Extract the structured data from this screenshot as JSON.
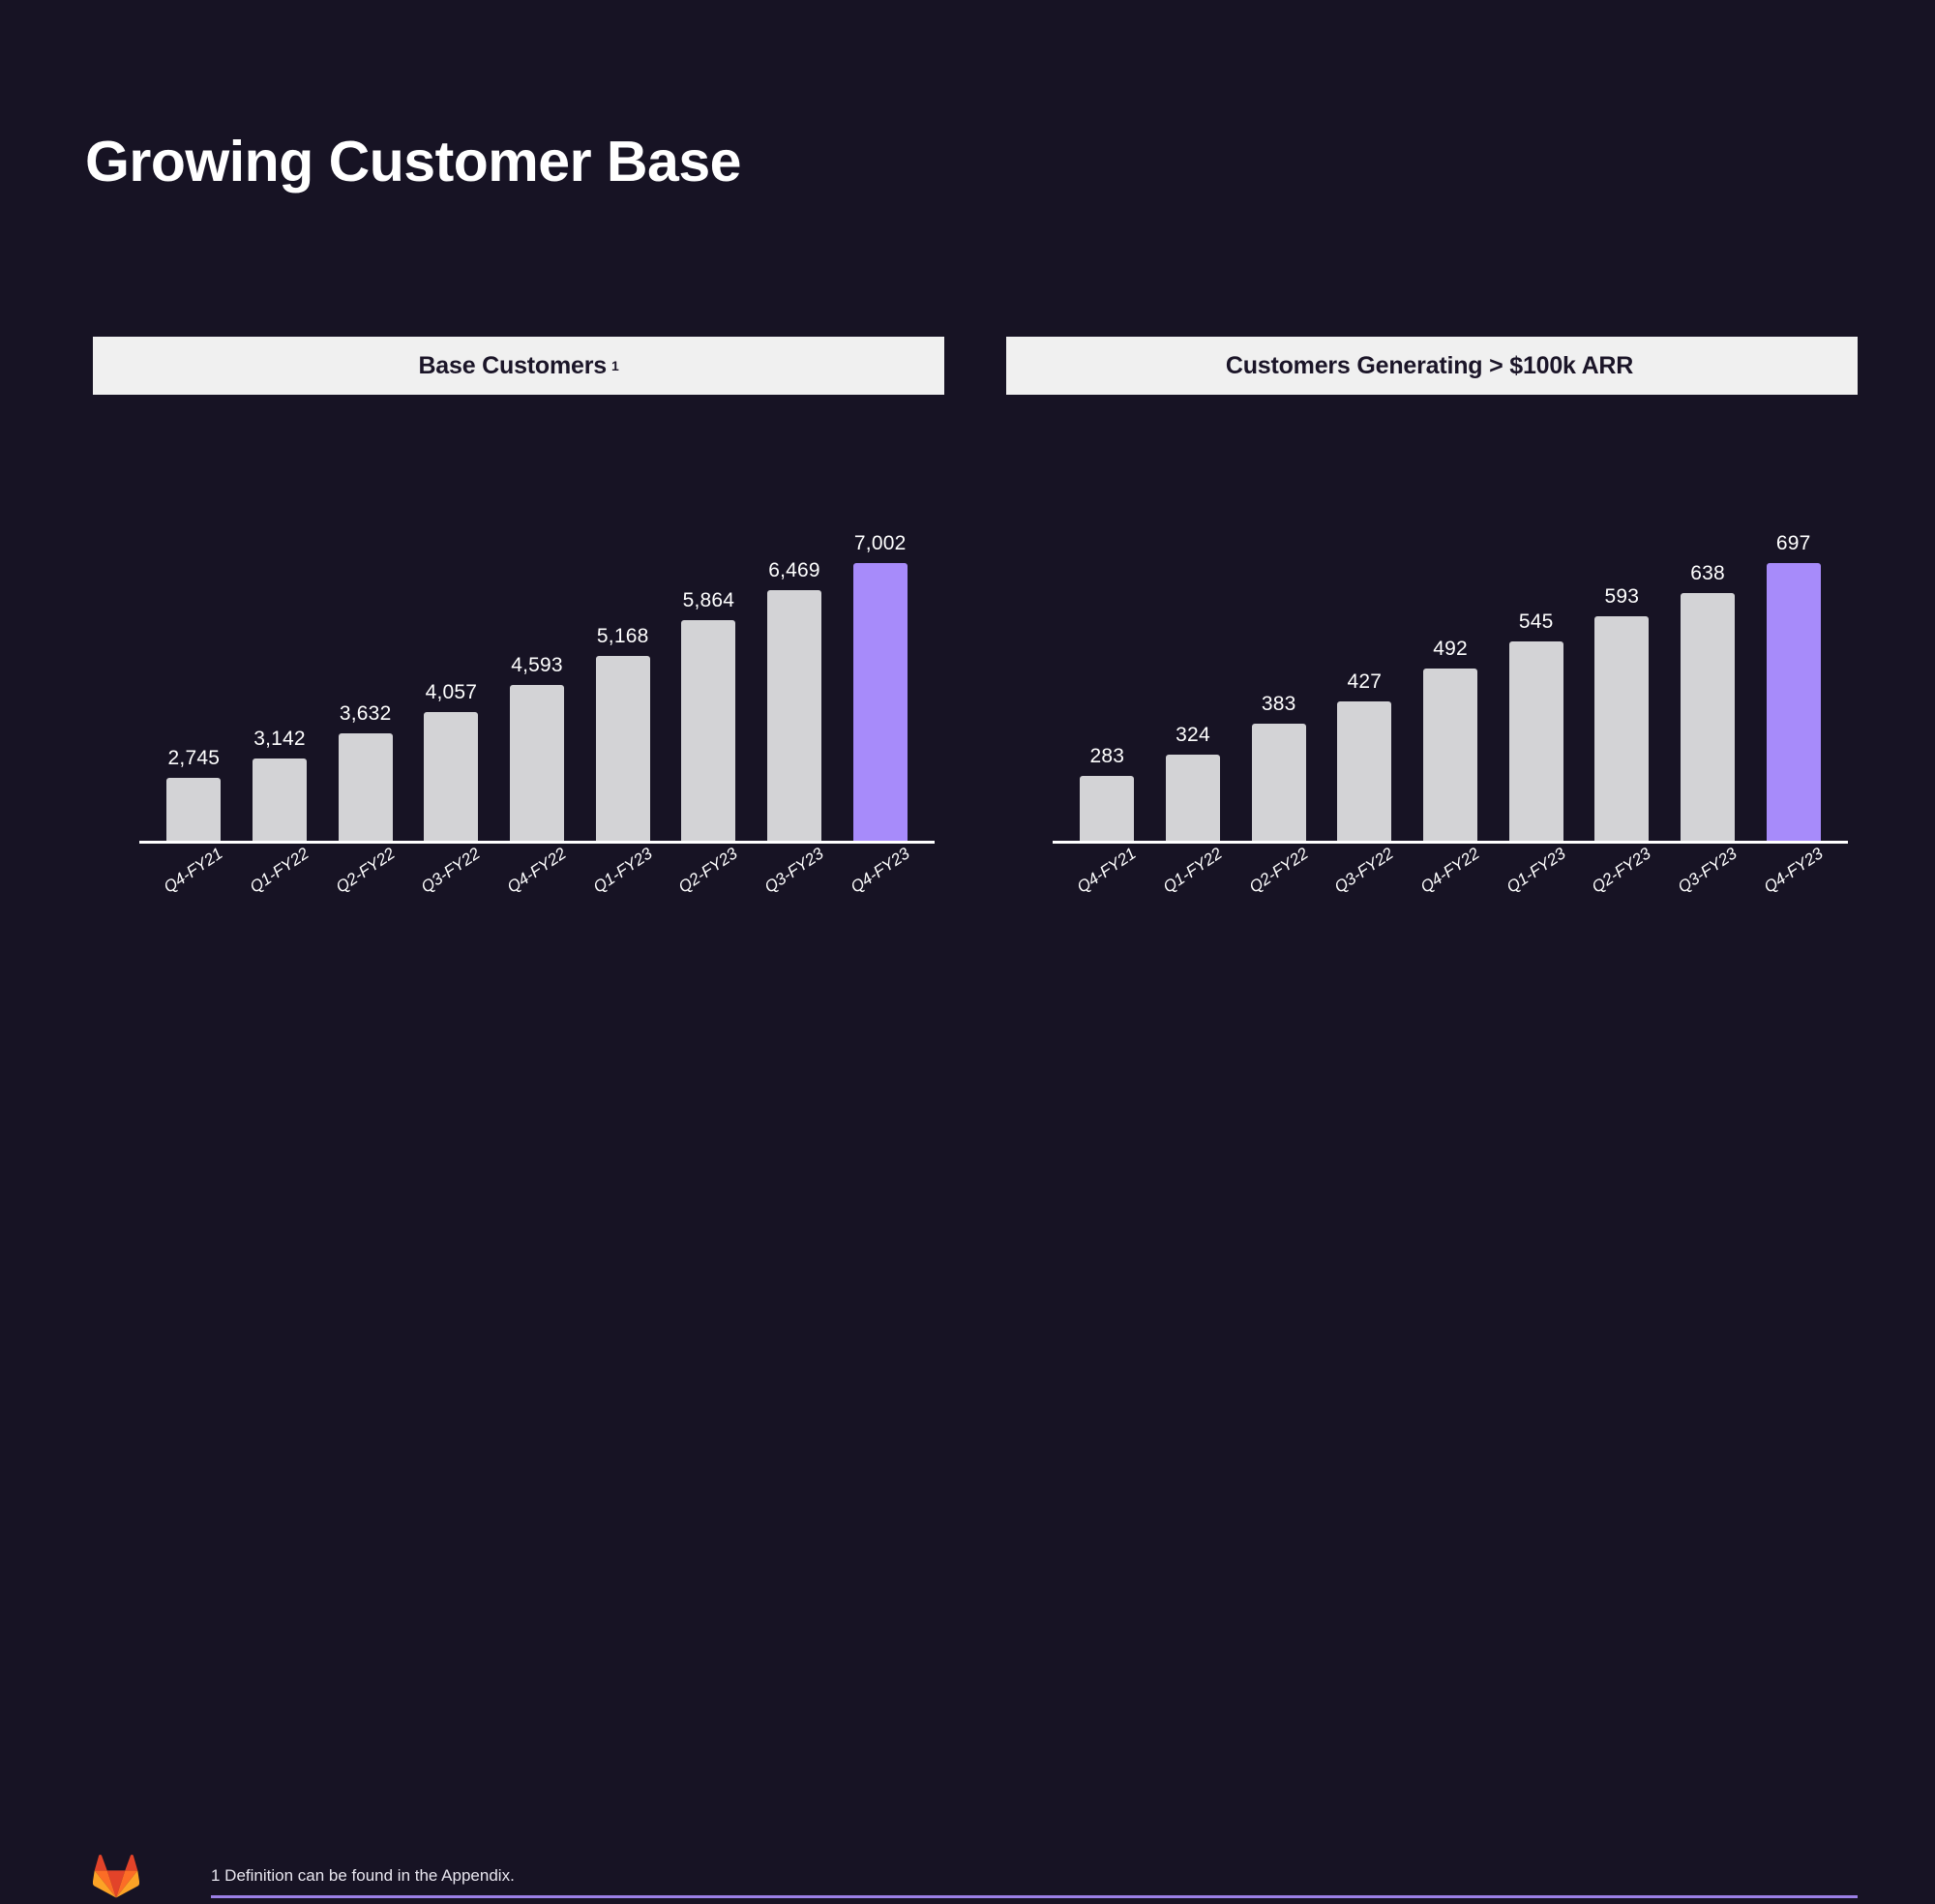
{
  "slide": {
    "title": "Growing Customer Base",
    "background_color": "#171324",
    "accent_color": "#a78bfa",
    "bar_color": "#d3d3d6",
    "header_bg_color": "#f0f0f0"
  },
  "footer": {
    "logo_name": "gitlab-tanuki-logo",
    "footnote": "1 Definition can be found in the Appendix.",
    "rule_color": "#9b7fe6"
  },
  "panels": [
    {
      "title": "Base Customers",
      "superscript": "1"
    },
    {
      "title": "Customers Generating > $100k ARR",
      "superscript": ""
    }
  ],
  "chart_data": [
    {
      "type": "bar",
      "title": "Base Customers 1",
      "xlabel": "",
      "ylabel": "",
      "grid": false,
      "legend": "none",
      "ylim": [
        1450,
        7002
      ],
      "categories": [
        "Q4-FY21",
        "Q1-FY22",
        "Q2-FY22",
        "Q3-FY22",
        "Q4-FY22",
        "Q1-FY23",
        "Q2-FY23",
        "Q3-FY23",
        "Q4-FY23"
      ],
      "values": [
        2745,
        3142,
        3632,
        4057,
        4593,
        5168,
        5864,
        6469,
        7002
      ],
      "value_labels": [
        "2,745",
        "3,142",
        "3,632",
        "4,057",
        "4,593",
        "5,168",
        "5,864",
        "6,469",
        "7,002"
      ],
      "highlight_index": 8,
      "highlight_color": "#a78bfa",
      "bar_color": "#d3d3d6"
    },
    {
      "type": "bar",
      "title": "Customers Generating > $100k ARR",
      "xlabel": "",
      "ylabel": "",
      "grid": false,
      "legend": "none",
      "ylim": [
        150,
        697
      ],
      "categories": [
        "Q4-FY21",
        "Q1-FY22",
        "Q2-FY22",
        "Q3-FY22",
        "Q4-FY22",
        "Q1-FY23",
        "Q2-FY23",
        "Q3-FY23",
        "Q4-FY23"
      ],
      "values": [
        283,
        324,
        383,
        427,
        492,
        545,
        593,
        638,
        697
      ],
      "value_labels": [
        "283",
        "324",
        "383",
        "427",
        "492",
        "545",
        "593",
        "638",
        "697"
      ],
      "highlight_index": 8,
      "highlight_color": "#a78bfa",
      "bar_color": "#d3d3d6"
    }
  ]
}
